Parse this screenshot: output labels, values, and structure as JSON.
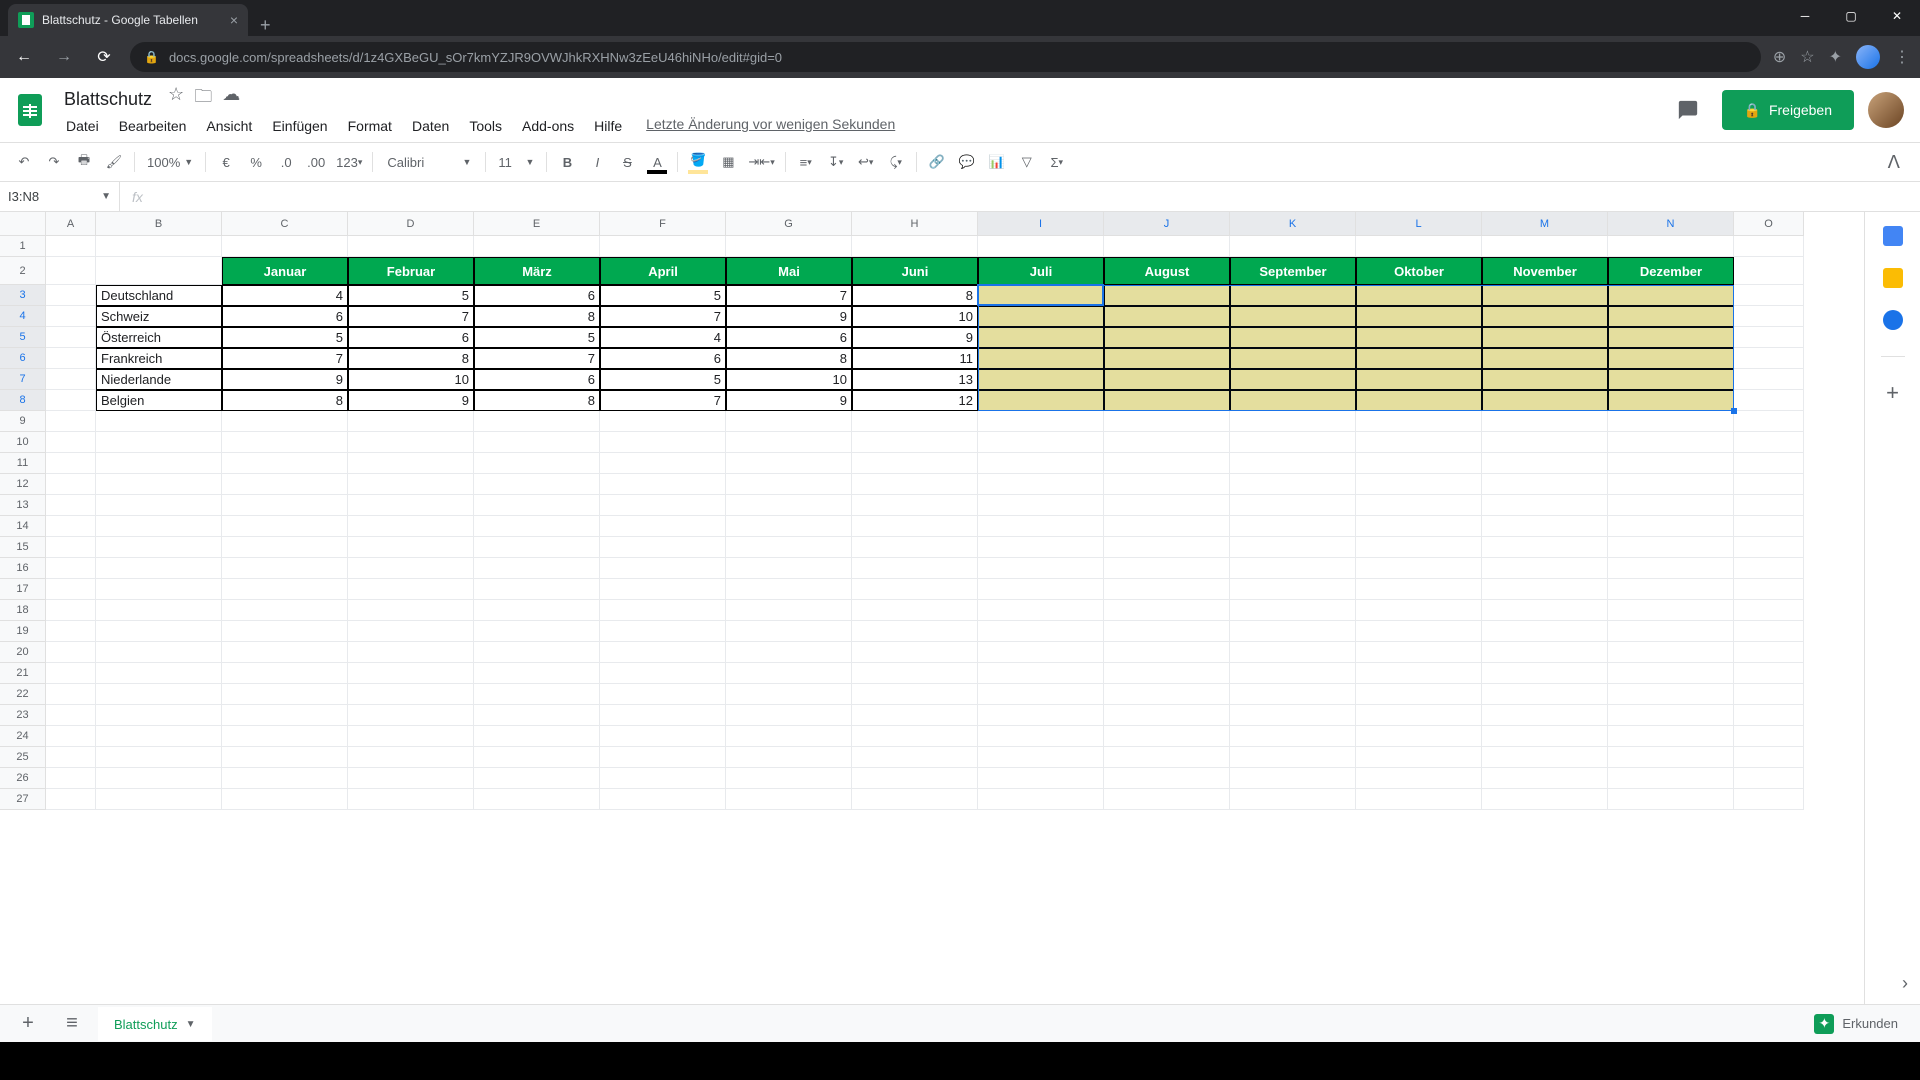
{
  "browser": {
    "tab_title": "Blattschutz - Google Tabellen",
    "url": "docs.google.com/spreadsheets/d/1z4GXBeGU_sOr7kmYZJR9OVWJhkRXHNw3zEeU46hiNHo/edit#gid=0"
  },
  "doc": {
    "title": "Blattschutz",
    "last_edit": "Letzte Änderung vor wenigen Sekunden",
    "share_label": "Freigeben"
  },
  "menus": [
    "Datei",
    "Bearbeiten",
    "Ansicht",
    "Einfügen",
    "Format",
    "Daten",
    "Tools",
    "Add-ons",
    "Hilfe"
  ],
  "toolbar": {
    "zoom": "100%",
    "currency": "€",
    "percent": "%",
    "dec_dec": ".0",
    "inc_dec": ".00",
    "more_formats": "123",
    "font": "Calibri",
    "font_size": "11",
    "text_color": "#000000",
    "fill_color": "#ffe599"
  },
  "name_box": "I3:N8",
  "columns": [
    "A",
    "B",
    "C",
    "D",
    "E",
    "F",
    "G",
    "H",
    "I",
    "J",
    "K",
    "L",
    "M",
    "N",
    "O"
  ],
  "selected_cols": [
    "I",
    "J",
    "K",
    "L",
    "M",
    "N"
  ],
  "selected_rows": [
    3,
    4,
    5,
    6,
    7,
    8
  ],
  "row_count": 27,
  "months": [
    "Januar",
    "Februar",
    "März",
    "April",
    "Mai",
    "Juni",
    "Juli",
    "August",
    "September",
    "Oktober",
    "November",
    "Dezember"
  ],
  "countries": [
    "Deutschland",
    "Schweiz",
    "Österreich",
    "Frankreich",
    "Niederlande",
    "Belgien"
  ],
  "data": [
    [
      4,
      5,
      6,
      5,
      7,
      8
    ],
    [
      6,
      7,
      8,
      7,
      9,
      10
    ],
    [
      5,
      6,
      5,
      4,
      6,
      9
    ],
    [
      7,
      8,
      7,
      6,
      8,
      11
    ],
    [
      9,
      10,
      6,
      5,
      10,
      13
    ],
    [
      8,
      9,
      8,
      7,
      9,
      12
    ]
  ],
  "sheet_tab": "Blattschutz",
  "explore_label": "Erkunden",
  "chart_data": {
    "type": "table",
    "title": "Monthly values by country",
    "columns": [
      "Januar",
      "Februar",
      "März",
      "April",
      "Mai",
      "Juni"
    ],
    "rows": [
      "Deutschland",
      "Schweiz",
      "Österreich",
      "Frankreich",
      "Niederlande",
      "Belgien"
    ],
    "values": [
      [
        4,
        5,
        6,
        5,
        7,
        8
      ],
      [
        6,
        7,
        8,
        7,
        9,
        10
      ],
      [
        5,
        6,
        5,
        4,
        6,
        9
      ],
      [
        7,
        8,
        7,
        6,
        8,
        11
      ],
      [
        9,
        10,
        6,
        5,
        10,
        13
      ],
      [
        8,
        9,
        8,
        7,
        9,
        12
      ]
    ],
    "empty_columns": [
      "Juli",
      "August",
      "September",
      "Oktober",
      "November",
      "Dezember"
    ]
  }
}
